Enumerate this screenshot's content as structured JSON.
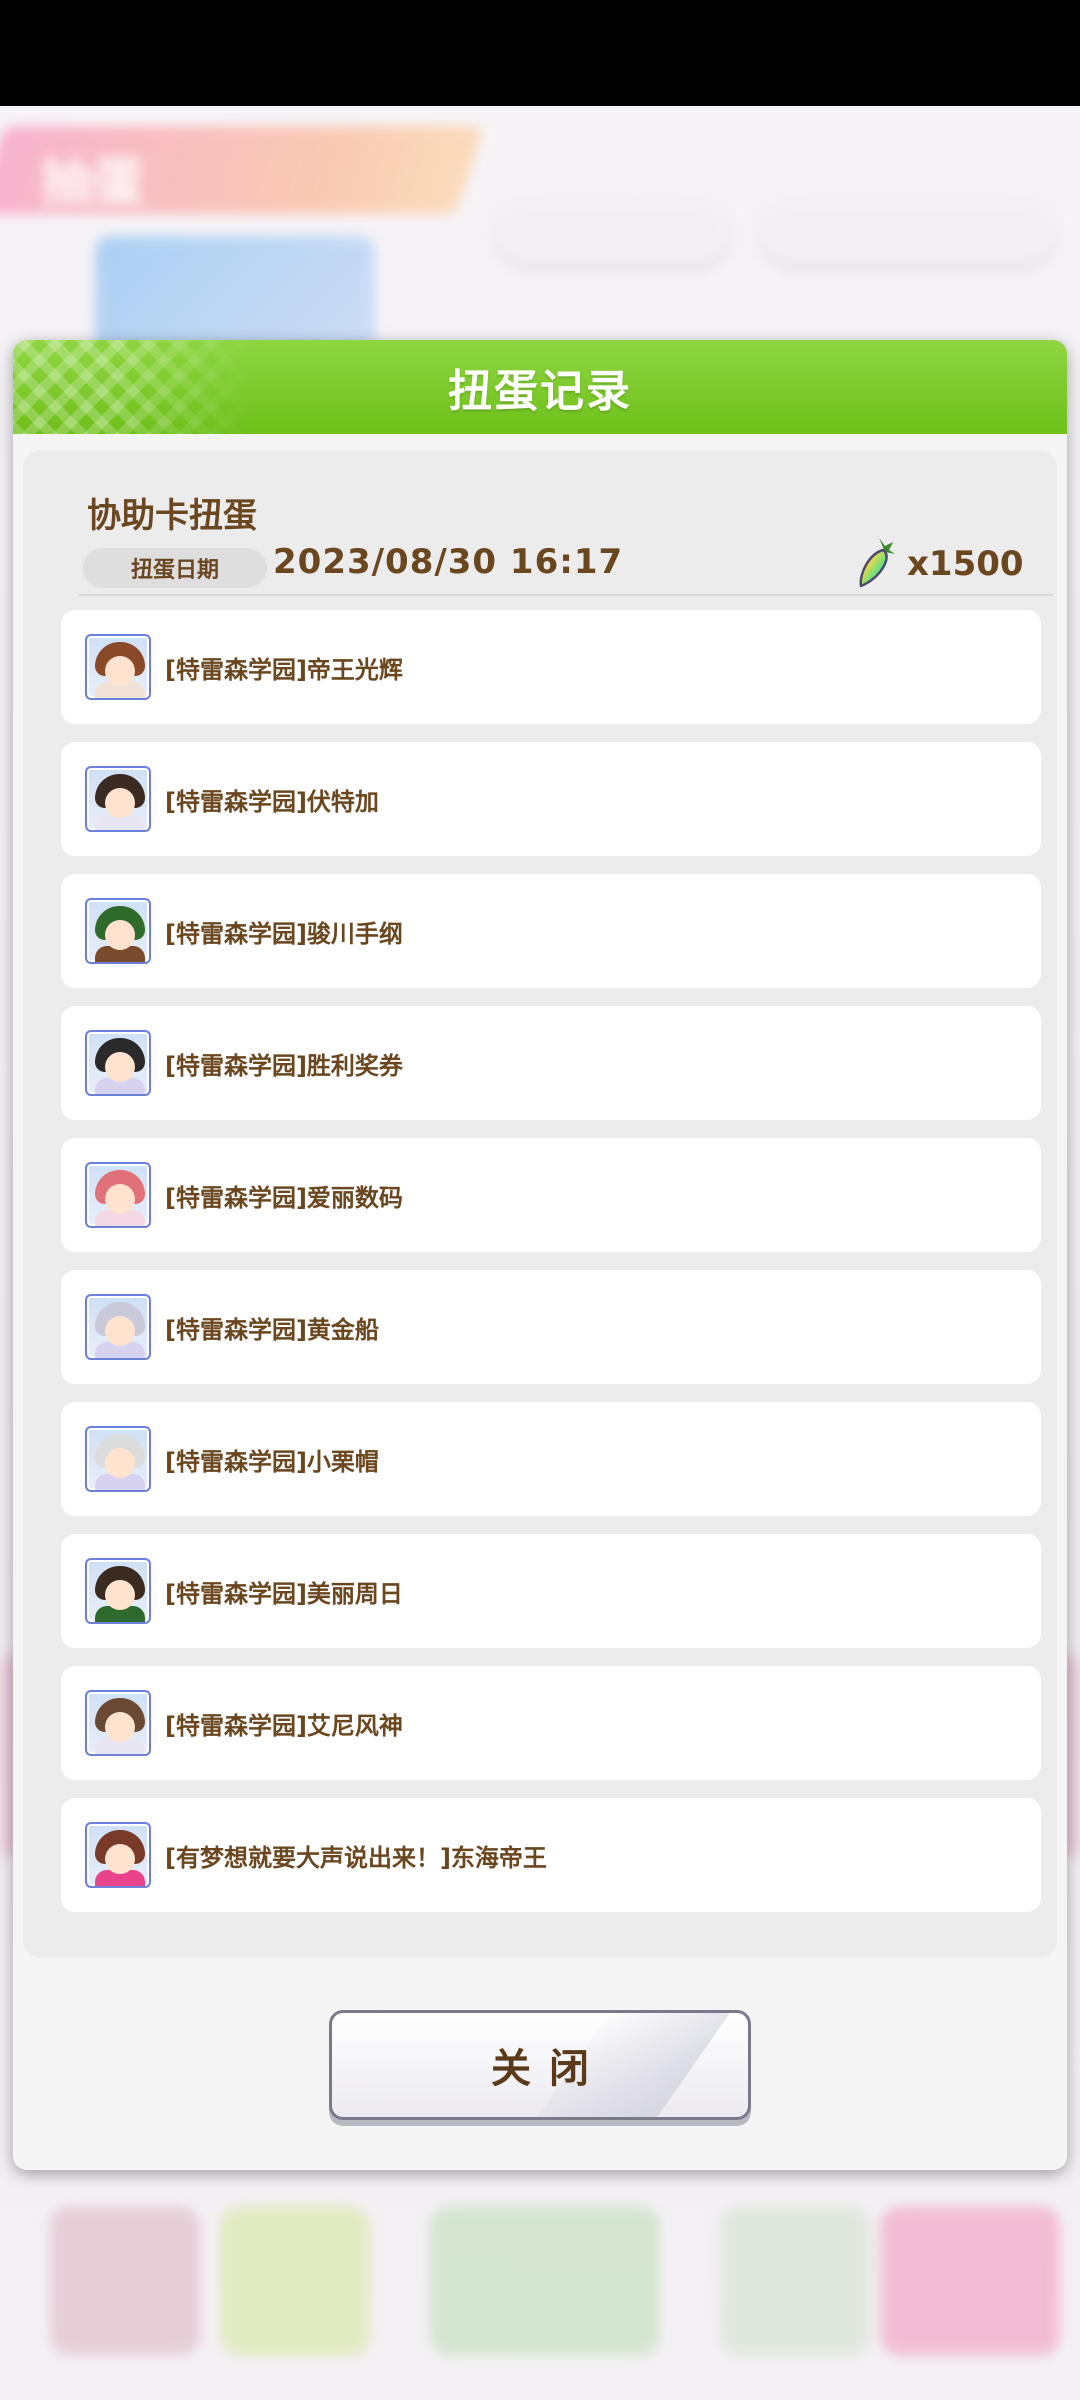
{
  "background": {
    "header_text": "抽蛋",
    "bottom_items": [
      "",
      "",
      "",
      "",
      ""
    ]
  },
  "modal": {
    "title": "扭蛋记录",
    "record": {
      "title": "协助卡扭蛋",
      "date_label": "扭蛋日期",
      "date_value": "2023/08/30  16:17",
      "cost_icon": "rainbow-carrot-icon",
      "cost_value": "x1500"
    },
    "items": [
      {
        "name": "[特雷森学园]帝王光辉",
        "avatar_colors": [
          "#8a4a2a",
          "#f1e1d6"
        ]
      },
      {
        "name": "[特雷森学园]伏特加",
        "avatar_colors": [
          "#3b2a22",
          "#e8e6f2"
        ]
      },
      {
        "name": "[特雷森学园]骏川手纲",
        "avatar_colors": [
          "#2f6b2a",
          "#7a4a2c"
        ]
      },
      {
        "name": "[特雷森学园]胜利奖券",
        "avatar_colors": [
          "#2a2a2a",
          "#d6d2ef"
        ]
      },
      {
        "name": "[特雷森学园]爱丽数码",
        "avatar_colors": [
          "#e0717a",
          "#f4d8e3"
        ]
      },
      {
        "name": "[特雷森学园]黄金船",
        "avatar_colors": [
          "#c9c9d9",
          "#d6d2ef"
        ]
      },
      {
        "name": "[特雷森学园]小栗帽",
        "avatar_colors": [
          "#dcdcdc",
          "#d6d2ef"
        ]
      },
      {
        "name": "[特雷森学园]美丽周日",
        "avatar_colors": [
          "#3a2a1f",
          "#2e6a2e"
        ]
      },
      {
        "name": "[特雷森学园]艾尼风神",
        "avatar_colors": [
          "#6a4a34",
          "#e9e6f3"
        ]
      },
      {
        "name": "[有梦想就要大声说出来！]东海帝王",
        "avatar_colors": [
          "#7a3a2a",
          "#e9438c"
        ]
      }
    ],
    "close_button": "关闭"
  }
}
